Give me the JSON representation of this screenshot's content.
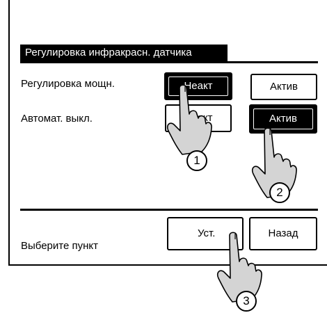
{
  "dialog": {
    "title": "Регулировка инфракрасн. датчика",
    "prompt": "Выберите пункт"
  },
  "settings": [
    {
      "label": "Регулировка мощн.",
      "options": [
        "Неакт",
        "Актив"
      ],
      "selected": "Неакт"
    },
    {
      "label": "Автомат. выкл.",
      "options": [
        "Неакт",
        "Актив"
      ],
      "selected": "Актив"
    }
  ],
  "footer": {
    "set_label": "Уст.",
    "back_label": "Назад"
  },
  "callouts": [
    "1",
    "2",
    "3"
  ]
}
